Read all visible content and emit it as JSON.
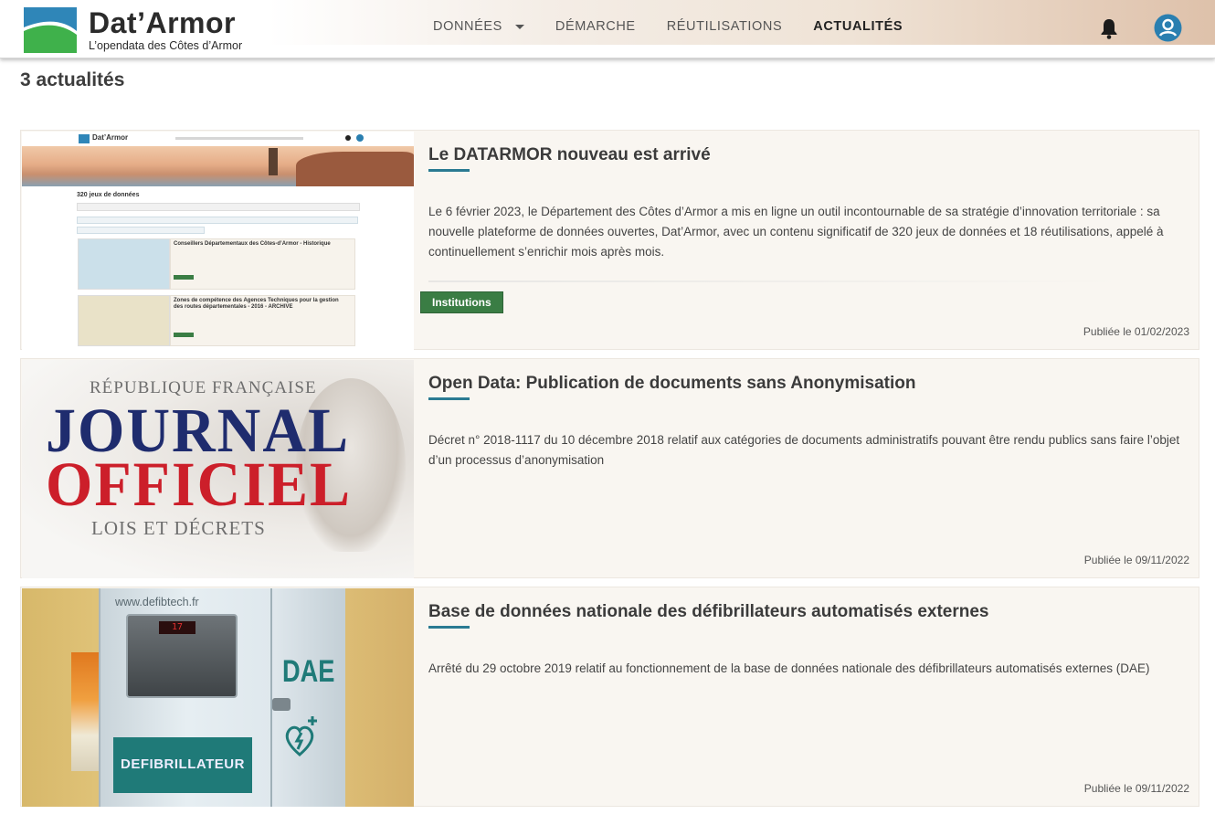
{
  "header": {
    "brand_name": "Dat’Armor",
    "brand_sub": "L’opendata des Côtes d’Armor",
    "nav": [
      {
        "label": "DONNÉES",
        "has_dropdown": true,
        "active": false
      },
      {
        "label": "DÉMARCHE",
        "has_dropdown": false,
        "active": false
      },
      {
        "label": "RÉUTILISATIONS",
        "has_dropdown": false,
        "active": false
      },
      {
        "label": "ACTUALITÉS",
        "has_dropdown": false,
        "active": true
      }
    ],
    "icons": [
      "bell-icon",
      "account-icon"
    ]
  },
  "colors": {
    "accent": "#2a7a92",
    "tag": "#3a7d44",
    "card_bg": "#f9f6f1"
  },
  "list": {
    "count": "3 actualités",
    "items": [
      {
        "title": "Le DATARMOR nouveau est arrivé",
        "text": "Le 6 février 2023, le Département des Côtes d’Armor a mis en ligne un outil incontournable de sa stratégie d’innovation territoriale : sa nouvelle plateforme de données ouvertes, Dat’Armor, avec un contenu significatif de 320 jeux de données et 18 réutilisations, appelé à continuellement s’enrichir mois après mois.",
        "tag": "Institutions",
        "date": "Publiée le 01/02/2023",
        "image": {
          "brand": "Dat’Armor",
          "count": "320 jeux de données",
          "result1_title": "Conseillers Départementaux des Côtes-d’Armor - Historique",
          "result2_title": "Zones de compétence des Agences Techniques pour la gestion des routes départementales - 2016 - ARCHIVE"
        }
      },
      {
        "title": "Open Data: Publication de documents sans Anonymisation",
        "text": "Décret n° 2018-1117 du 10 décembre 2018 relatif aux catégories de documents administratifs pouvant être rendu publics sans faire l’objet d’un processus d’anonymisation",
        "date": "Publiée le 09/11/2022",
        "image": {
          "line1": "RÉPUBLIQUE FRANÇAISE",
          "line2": "JOURNAL",
          "line3": "OFFICIEL",
          "line4": "LOIS ET DÉCRETS"
        }
      },
      {
        "title": "Base de données nationale des défibrillateurs automatisés externes",
        "text": "Arrêté du 29 octobre 2019 relatif au fonctionnement de la base de données nationale des défibrillateurs automatisés externes (DAE)",
        "date": "Publiée le 09/11/2022",
        "image": {
          "url": "www.defibtech.fr",
          "box_label": "DEFIBRILLATEUR",
          "door_label": "DAE",
          "display": "17"
        }
      }
    ]
  }
}
